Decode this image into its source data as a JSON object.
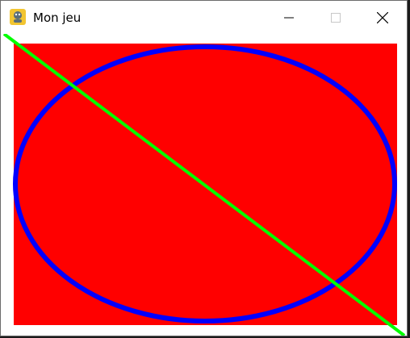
{
  "window": {
    "title": "Mon jeu",
    "app_icon": "pygame-snake-icon",
    "controls": {
      "minimize_icon": "minimize-icon",
      "maximize_icon": "maximize-icon",
      "close_icon": "close-icon"
    }
  },
  "scene": {
    "background_color": "#ffffff",
    "rectangle_color": "#ff0000",
    "ellipse_color": "#0000ff",
    "line_color": "#00ff00"
  }
}
